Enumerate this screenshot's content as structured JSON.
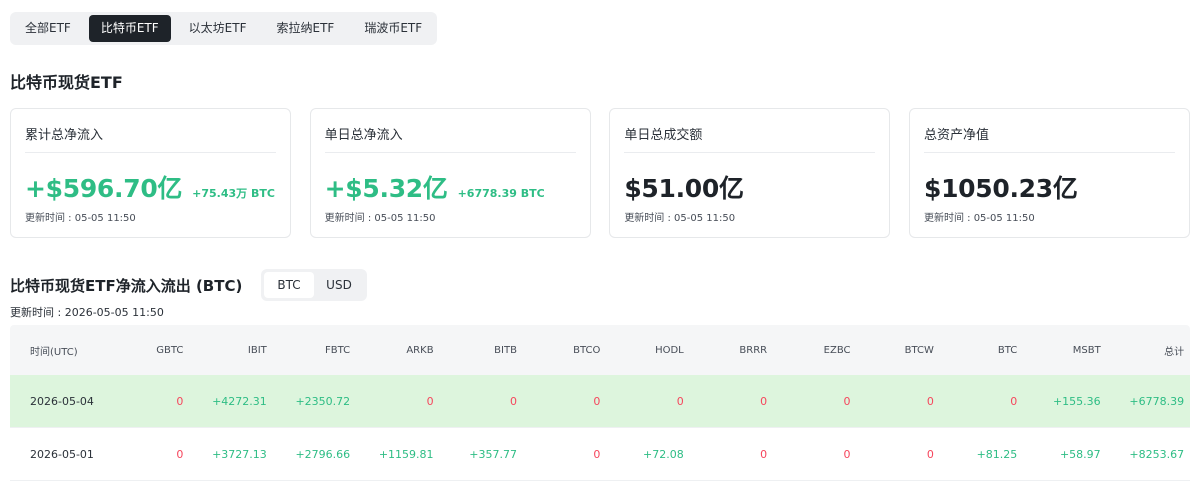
{
  "tabs": [
    "全部ETF",
    "比特币ETF",
    "以太坊ETF",
    "索拉纳ETF",
    "瑞波币ETF"
  ],
  "active_tab_index": 1,
  "section_title": "比特币现货ETF",
  "cards": [
    {
      "label": "累计总净流入",
      "value": "+$596.70亿",
      "sub": "+75.43万 BTC",
      "time": "更新时间 : 05-05 11:50",
      "positive": true
    },
    {
      "label": "单日总净流入",
      "value": "+$5.32亿",
      "sub": "+6778.39 BTC",
      "time": "更新时间 : 05-05 11:50",
      "positive": true
    },
    {
      "label": "单日总成交额",
      "value": "$51.00亿",
      "sub": "",
      "time": "更新时间 : 05-05 11:50",
      "positive": false
    },
    {
      "label": "总资产净值",
      "value": "$1050.23亿",
      "sub": "",
      "time": "更新时间 : 05-05 11:50",
      "positive": false
    }
  ],
  "flow": {
    "title": "比特币现货ETF净流入流出 (BTC)",
    "toggle": [
      "BTC",
      "USD"
    ],
    "active_toggle_index": 0,
    "update_time": "更新时间 : 2026-05-05 11:50"
  },
  "colors": {
    "positive": "#2ebd85",
    "negative": "#f6465d",
    "highlight_row": "#ddf5dd",
    "active_tab": "#1e2329"
  },
  "table": {
    "columns": [
      "时间(UTC)",
      "GBTC",
      "IBIT",
      "FBTC",
      "ARKB",
      "BITB",
      "BTCO",
      "HODL",
      "BRRR",
      "EZBC",
      "BTCW",
      "BTC",
      "MSBT",
      "总计"
    ],
    "rows": [
      {
        "cells": [
          "2026-05-04",
          "0",
          "+4272.31",
          "+2350.72",
          "0",
          "0",
          "0",
          "0",
          "0",
          "0",
          "0",
          "0",
          "+155.36",
          "+6778.39"
        ],
        "highlight": true
      },
      {
        "cells": [
          "2026-05-01",
          "0",
          "+3727.13",
          "+2796.66",
          "+1159.81",
          "+357.77",
          "0",
          "+72.08",
          "0",
          "0",
          "0",
          "+81.25",
          "+58.97",
          "+8253.67"
        ],
        "highlight": false
      }
    ]
  }
}
